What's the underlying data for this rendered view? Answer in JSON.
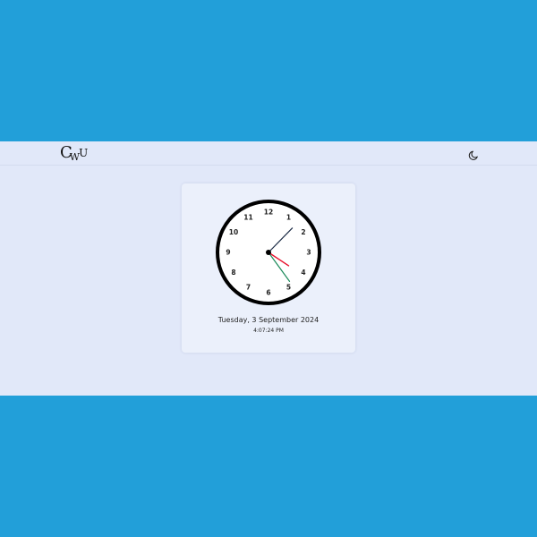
{
  "header": {
    "logo": {
      "c": "C",
      "w": "W",
      "u": "U"
    },
    "theme_toggle_icon": "moon-icon"
  },
  "clock": {
    "numbers": [
      "12",
      "1",
      "2",
      "3",
      "4",
      "5",
      "6",
      "7",
      "8",
      "9",
      "10",
      "11"
    ],
    "time": {
      "hours": 4,
      "minutes": 7,
      "seconds": 24
    },
    "colors": {
      "face_border": "#000000",
      "hour_hand": "#e8112d",
      "minute_hand": "#1a2a44",
      "second_hand": "#1b8a5a"
    }
  },
  "date_text": "Tuesday, 3 September 2024",
  "time_text": "4:07:24 PM",
  "colors": {
    "background": "#229fd9",
    "page": "#e1e8f9",
    "card": "#ebf0fb"
  }
}
